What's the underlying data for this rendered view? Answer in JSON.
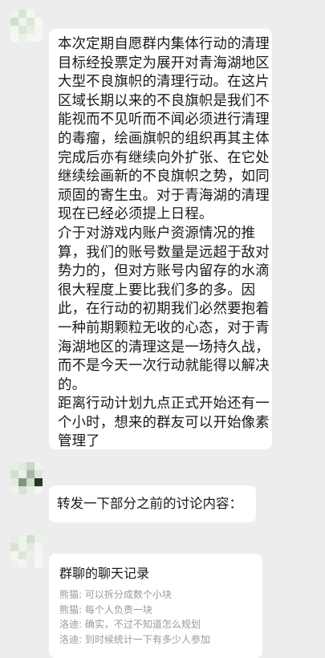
{
  "messages": [
    {
      "type": "text",
      "paragraphs": [
        "本次定期自愿群内集体行动的清理\n目标经投票定为展开对青海湖地区\n大型不良旗帜的清理行动。在这片\n区域长期以来的不良旗帜是我们不\n能视而不见听而不闻必须进行清理\n的毒瘤，绘画旗帜的组织再其主体\n完成后亦有继续向外扩张、在它处\n继续绘画新的不良旗帜之势，如同\n顽固的寄生虫。对于青海湖的清理\n现在已经必须提上日程。",
        "介于对游戏内账户资源情况的推\n算，我们的账号数量是远超于敌对\n势力的，但对方账号内留存的水滴\n很大程度上要比我们多的多。因\n此，在行动的初期我们必然要抱着\n一种前期颗粒无收的心态，对于青\n海湖地区的清理这是一场持久战，\n而不是今天一次行动就能得以解决\n的。",
        "距离行动计划九点正式开始还有一\n个小时，想来的群友可以开始像素\n管理了"
      ]
    },
    {
      "type": "text",
      "text": "转发一下部分之前的讨论内容："
    },
    {
      "type": "chat-record",
      "title": "群聊的聊天记录",
      "lines": [
        "熊猫: 可以拆分成数个小块",
        "熊猫: 每个人负责一块",
        "洛迪: 确实，不过不知道怎么规划",
        "洛迪: 到时候统计一下有多少人参加"
      ]
    }
  ],
  "colors": {
    "background": "#ededed",
    "bubble": "#ffffff",
    "text": "#1a1a1a",
    "muted": "#9a9a9a"
  }
}
